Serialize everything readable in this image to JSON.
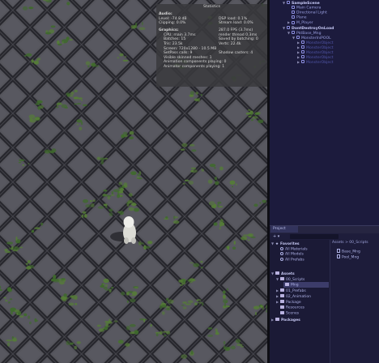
{
  "stats": {
    "title": "Statistics",
    "audio_label": "Audio:",
    "audio_rows": [
      {
        "left": "Level: -74.8 dB",
        "right": "DSP load: 0.1%"
      },
      {
        "left": "Clipping: 0.0%",
        "right": "Stream load: 0.0%"
      }
    ],
    "graphics_label": "Graphics:",
    "graphics_fps": "287.0 FPS (3.7ms)",
    "graphics_lines": [
      {
        "left": "CPU: main 3.7ms",
        "right": "render thread 0.3ms"
      },
      {
        "left": "Batches: 15",
        "right": "Saved by batching: 0"
      },
      {
        "left": "Tris: 23.5k",
        "right": "Verts: 22.4k"
      },
      {
        "left": "Screen: 720x1280 - 10.5 MB",
        "right": ""
      },
      {
        "left": "SetPass calls: 9",
        "right": "Shadow casters: 4"
      },
      {
        "left": "Visible skinned meshes: 1",
        "right": ""
      },
      {
        "left": "Animation components playing: 0",
        "right": ""
      },
      {
        "left": "Animator components playing: 1",
        "right": ""
      }
    ]
  },
  "hierarchy": {
    "items": [
      {
        "label": "SampleScene",
        "indent": 0,
        "style": "bold",
        "arrow": "▼",
        "icon": "scene-icon"
      },
      {
        "label": "Main Camera",
        "indent": 1,
        "style": "normal",
        "arrow": "",
        "icon": "gameobject-icon"
      },
      {
        "label": "Directional Light",
        "indent": 1,
        "style": "normal",
        "arrow": "",
        "icon": "gameobject-icon"
      },
      {
        "label": "Plane",
        "indent": 1,
        "style": "normal",
        "arrow": "",
        "icon": "gameobject-icon"
      },
      {
        "label": "M_Player",
        "indent": 1,
        "style": "normal",
        "arrow": "▶",
        "icon": "gameobject-icon"
      },
      {
        "label": "DontDestroyOnLoad",
        "indent": 0,
        "style": "bold",
        "arrow": "▼",
        "icon": "scene-icon"
      },
      {
        "label": "PktBase_Mng",
        "indent": 1,
        "style": "normal",
        "arrow": "▼",
        "icon": "gameobject-icon"
      },
      {
        "label": "MonsterIniPOOL",
        "indent": 2,
        "style": "normal",
        "arrow": "▼",
        "icon": "gameobject-icon"
      },
      {
        "label": "MonsterObject",
        "indent": 3,
        "style": "dim",
        "arrow": "▶",
        "icon": "gameobject-icon"
      },
      {
        "label": "MonsterObject",
        "indent": 3,
        "style": "dim",
        "arrow": "▶",
        "icon": "gameobject-icon"
      },
      {
        "label": "MonsterObject",
        "indent": 3,
        "style": "dim",
        "arrow": "▶",
        "icon": "gameobject-icon"
      },
      {
        "label": "MonsterObject",
        "indent": 3,
        "style": "dim",
        "arrow": "▶",
        "icon": "gameobject-icon"
      },
      {
        "label": "MonsterObject",
        "indent": 3,
        "style": "dim",
        "arrow": "▶",
        "icon": "gameobject-icon"
      }
    ]
  },
  "project": {
    "tab_label": "Project",
    "toolbar_add": "+ ▾",
    "tree": [
      {
        "label": "Favorites",
        "indent": 0,
        "kind": "header",
        "arrow": "▼",
        "icon": "star-icon"
      },
      {
        "label": "All Materials",
        "indent": 1,
        "kind": "search",
        "arrow": "",
        "icon": "search-icon"
      },
      {
        "label": "All Models",
        "indent": 1,
        "kind": "search",
        "arrow": "",
        "icon": "search-icon"
      },
      {
        "label": "All Prefabs",
        "indent": 1,
        "kind": "search",
        "arrow": "",
        "icon": "search-icon"
      },
      {
        "label": "",
        "indent": 0,
        "kind": "spacer",
        "arrow": "",
        "icon": ""
      },
      {
        "label": "Assets",
        "indent": 0,
        "kind": "header",
        "arrow": "▼",
        "icon": "folder-icon"
      },
      {
        "label": "00_Scripts",
        "indent": 1,
        "kind": "folder",
        "arrow": "▼",
        "icon": "folder-icon"
      },
      {
        "label": "Mng",
        "indent": 2,
        "kind": "folder",
        "arrow": "",
        "icon": "folder-icon"
      },
      {
        "label": "01_Prefabs",
        "indent": 1,
        "kind": "folder",
        "arrow": "▶",
        "icon": "folder-icon"
      },
      {
        "label": "02_Animation",
        "indent": 1,
        "kind": "folder",
        "arrow": "▶",
        "icon": "folder-icon"
      },
      {
        "label": "Package",
        "indent": 1,
        "kind": "folder",
        "arrow": "▶",
        "icon": "folder-icon"
      },
      {
        "label": "Resources",
        "indent": 1,
        "kind": "folder",
        "arrow": "",
        "icon": "folder-icon"
      },
      {
        "label": "Scenes",
        "indent": 1,
        "kind": "folder",
        "arrow": "",
        "icon": "folder-icon"
      },
      {
        "label": "Packages",
        "indent": 0,
        "kind": "header",
        "arrow": "▶",
        "icon": "folder-icon"
      }
    ],
    "breadcrumb": "Assets > 00_Scripts",
    "assets": [
      {
        "label": "Base_Mng",
        "icon": "script-icon"
      },
      {
        "label": "Pool_Mng",
        "icon": "script-icon"
      }
    ]
  },
  "colors": {
    "ground": "#45454c",
    "tile_stroke": "#24242a",
    "moss": "#3f6a2c",
    "hierarchy_bg": "#1c1b3d",
    "accent_text": "#9aa0e0"
  }
}
